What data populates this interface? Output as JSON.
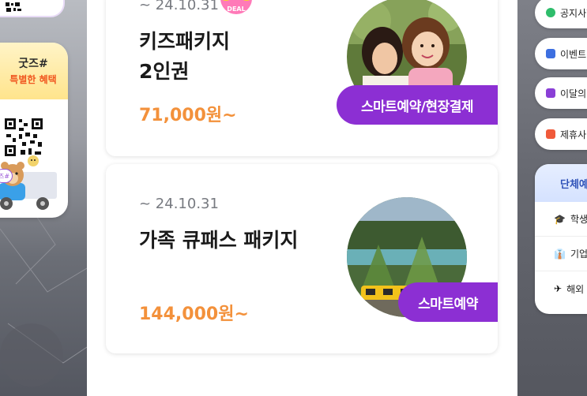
{
  "left_sidebar": {
    "goods_title": "굿즈#",
    "goods_subtitle": "특별한 혜택",
    "chat_bubble": "즈#"
  },
  "products": [
    {
      "period": "~ 24.10.31",
      "name_line1": "키즈패키지",
      "name_line2": "2인권",
      "price": "71,000원~",
      "badge": "스마트예약/현장결제",
      "deal_label": "DEAL",
      "image": "mother-and-daughter-photo"
    },
    {
      "period": "~ 24.10.31",
      "name_line1": "가족 큐패스 패키지",
      "price": "144,000원~",
      "badge": "스마트예약",
      "image": "theme-park-train-photo"
    }
  ],
  "right_menu": {
    "items": [
      {
        "label": "공지사항",
        "icon": "notice-icon",
        "color": "#2ebd6b"
      },
      {
        "label": "이벤트",
        "icon": "event-icon",
        "color": "#3d6fe0"
      },
      {
        "label": "이달의",
        "icon": "calendar-icon",
        "color": "#8a3fd6"
      },
      {
        "label": "제휴사",
        "icon": "partner-icon",
        "color": "#f05a3a"
      }
    ],
    "group": {
      "title": "단체예",
      "items": [
        {
          "label": "학생",
          "icon": "graduation-cap-icon"
        },
        {
          "label": "기업",
          "icon": "necktie-icon"
        },
        {
          "label": "해외",
          "icon": "airplane-icon"
        }
      ]
    }
  },
  "colors": {
    "accent_purple": "#8c2fd3",
    "price_orange": "#f3913b",
    "goods_highlight": "#f0561f"
  }
}
